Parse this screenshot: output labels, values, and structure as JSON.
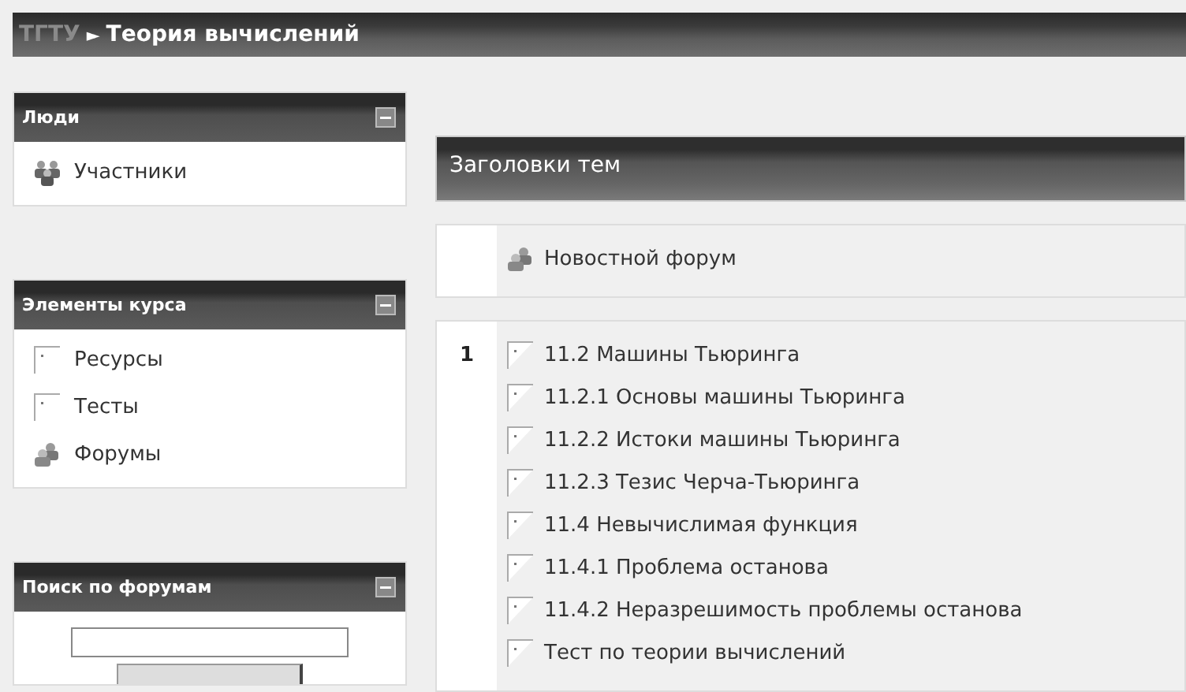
{
  "header": {
    "crumb": "ТГТУ",
    "arrow": "►",
    "title": "Теория вычислений"
  },
  "blocks": [
    {
      "title": "Люди",
      "items": [
        {
          "kind": "people",
          "label": "Участники"
        }
      ]
    },
    {
      "title": "Элементы курса",
      "items": [
        {
          "kind": "page",
          "label": "Ресурсы"
        },
        {
          "kind": "page",
          "label": "Тесты"
        },
        {
          "kind": "forum",
          "label": "Форумы"
        }
      ]
    },
    {
      "title": "Поиск по форумам",
      "kind": "search"
    }
  ],
  "topics": {
    "title": "Заголовки тем",
    "news": {
      "kind": "forum",
      "label": "Новостной форум"
    },
    "sections": [
      {
        "number": "1",
        "items": [
          {
            "kind": "page",
            "label": "11.2 Машины Тьюринга"
          },
          {
            "kind": "page",
            "label": "11.2.1 Основы машины Тьюринга"
          },
          {
            "kind": "page",
            "label": "11.2.2 Истоки машины Тьюринга"
          },
          {
            "kind": "page",
            "label": "11.2.3 Тезис Черча-Тьюринга"
          },
          {
            "kind": "page",
            "label": "11.4 Невычислимая функция"
          },
          {
            "kind": "page",
            "label": "11.4.1 Проблема останова"
          },
          {
            "kind": "page",
            "label": "11.4.2 Неразрешимость проблемы останова"
          },
          {
            "kind": "page",
            "label": "Тест по теории вычислений"
          }
        ]
      }
    ]
  }
}
